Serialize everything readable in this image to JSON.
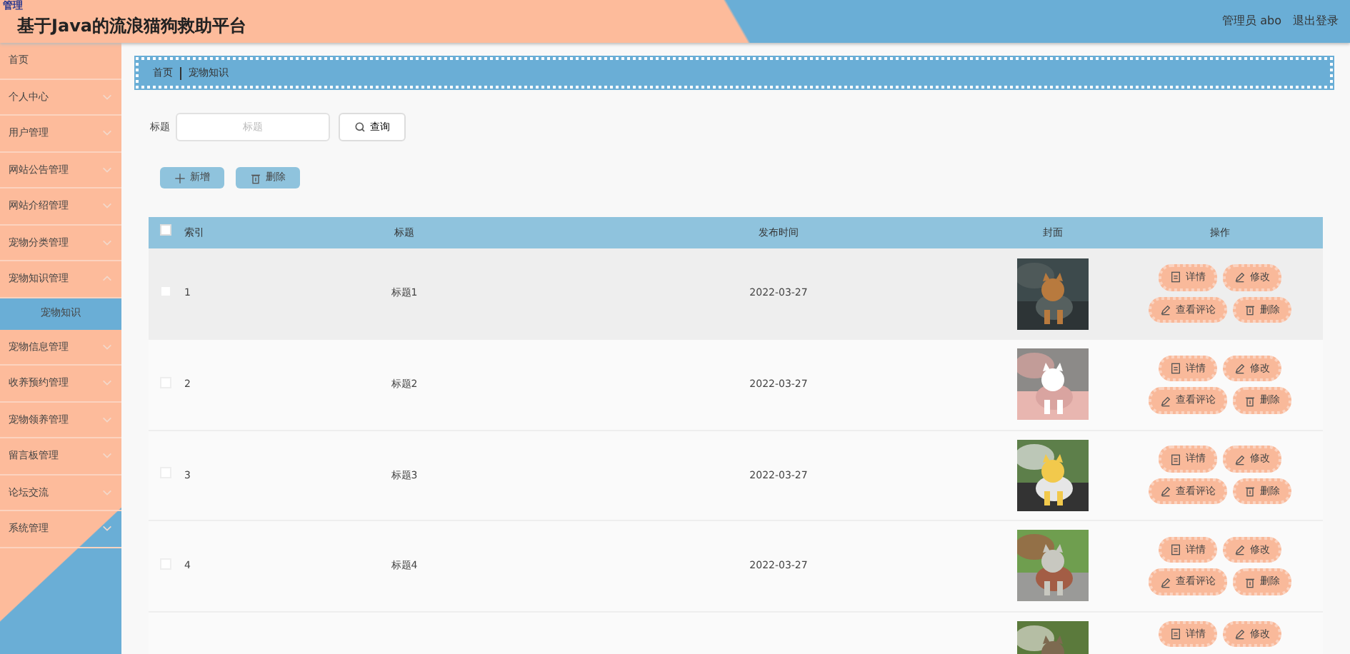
{
  "header": {
    "logo_text": "管理",
    "title": "基于Java的流浪猫狗救助平台",
    "user": "管理员 abo",
    "logout": "退出登录"
  },
  "sidebar": {
    "items": [
      {
        "label": "首页",
        "has_arrow": false
      },
      {
        "label": "个人中心",
        "has_arrow": true,
        "expanded": false
      },
      {
        "label": "用户管理",
        "has_arrow": true,
        "expanded": false
      },
      {
        "label": "网站公告管理",
        "has_arrow": true,
        "expanded": false
      },
      {
        "label": "网站介绍管理",
        "has_arrow": true,
        "expanded": false
      },
      {
        "label": "宠物分类管理",
        "has_arrow": true,
        "expanded": false
      },
      {
        "label": "宠物知识管理",
        "has_arrow": true,
        "expanded": true,
        "children": [
          {
            "label": "宠物知识",
            "selected": true
          }
        ]
      },
      {
        "label": "宠物信息管理",
        "has_arrow": true,
        "expanded": false
      },
      {
        "label": "收养预约管理",
        "has_arrow": true,
        "expanded": false
      },
      {
        "label": "宠物领养管理",
        "has_arrow": true,
        "expanded": false
      },
      {
        "label": "留言板管理",
        "has_arrow": true,
        "expanded": false
      },
      {
        "label": "论坛交流",
        "has_arrow": true,
        "expanded": false
      },
      {
        "label": "系统管理",
        "has_arrow": true,
        "expanded": false
      }
    ]
  },
  "breadcrumb": [
    "首页",
    "宠物知识"
  ],
  "search": {
    "label": "标题",
    "placeholder": "标题",
    "button": "查询"
  },
  "toolbar": [
    {
      "kind": "add",
      "label": "新增"
    },
    {
      "kind": "delete",
      "label": "删除"
    }
  ],
  "table": {
    "select_all_checked": false,
    "columns": [
      "索引",
      "标题",
      "发布时间",
      "封面",
      "操作"
    ],
    "rows": [
      {
        "checked": false,
        "hovered": true,
        "index": "1",
        "title": "标题1",
        "date": "2022-03-27",
        "cover": {
          "kind": "picture"
        },
        "actions": [
          {
            "kind": "detail",
            "label": "详情"
          },
          {
            "kind": "edit",
            "label": "修改"
          },
          {
            "kind": "comment",
            "label": "查看评论"
          },
          {
            "kind": "delete",
            "label": "删除"
          }
        ]
      },
      {
        "checked": false,
        "hovered": false,
        "index": "2",
        "title": "标题2",
        "date": "2022-03-27",
        "cover": {
          "kind": "picture"
        },
        "actions": [
          {
            "kind": "detail",
            "label": "详情"
          },
          {
            "kind": "edit",
            "label": "修改"
          },
          {
            "kind": "comment",
            "label": "查看评论"
          },
          {
            "kind": "delete",
            "label": "删除"
          }
        ]
      },
      {
        "checked": false,
        "hovered": false,
        "index": "3",
        "title": "标题3",
        "date": "2022-03-27",
        "cover": {
          "kind": "picture"
        },
        "actions": [
          {
            "kind": "detail",
            "label": "详情"
          },
          {
            "kind": "edit",
            "label": "修改"
          },
          {
            "kind": "comment",
            "label": "查看评论"
          },
          {
            "kind": "delete",
            "label": "删除"
          }
        ]
      },
      {
        "checked": false,
        "hovered": false,
        "index": "4",
        "title": "标题4",
        "date": "2022-03-27",
        "cover": {
          "kind": "picture"
        },
        "actions": [
          {
            "kind": "detail",
            "label": "详情"
          },
          {
            "kind": "edit",
            "label": "修改"
          },
          {
            "kind": "comment",
            "label": "查看评论"
          },
          {
            "kind": "delete",
            "label": "删除"
          }
        ]
      },
      {
        "hovered": false,
        "cover": {
          "kind": "picture"
        },
        "actions": [
          {
            "kind": "detail",
            "label": "详情"
          },
          {
            "kind": "edit",
            "label": "修改"
          }
        ]
      }
    ]
  }
}
